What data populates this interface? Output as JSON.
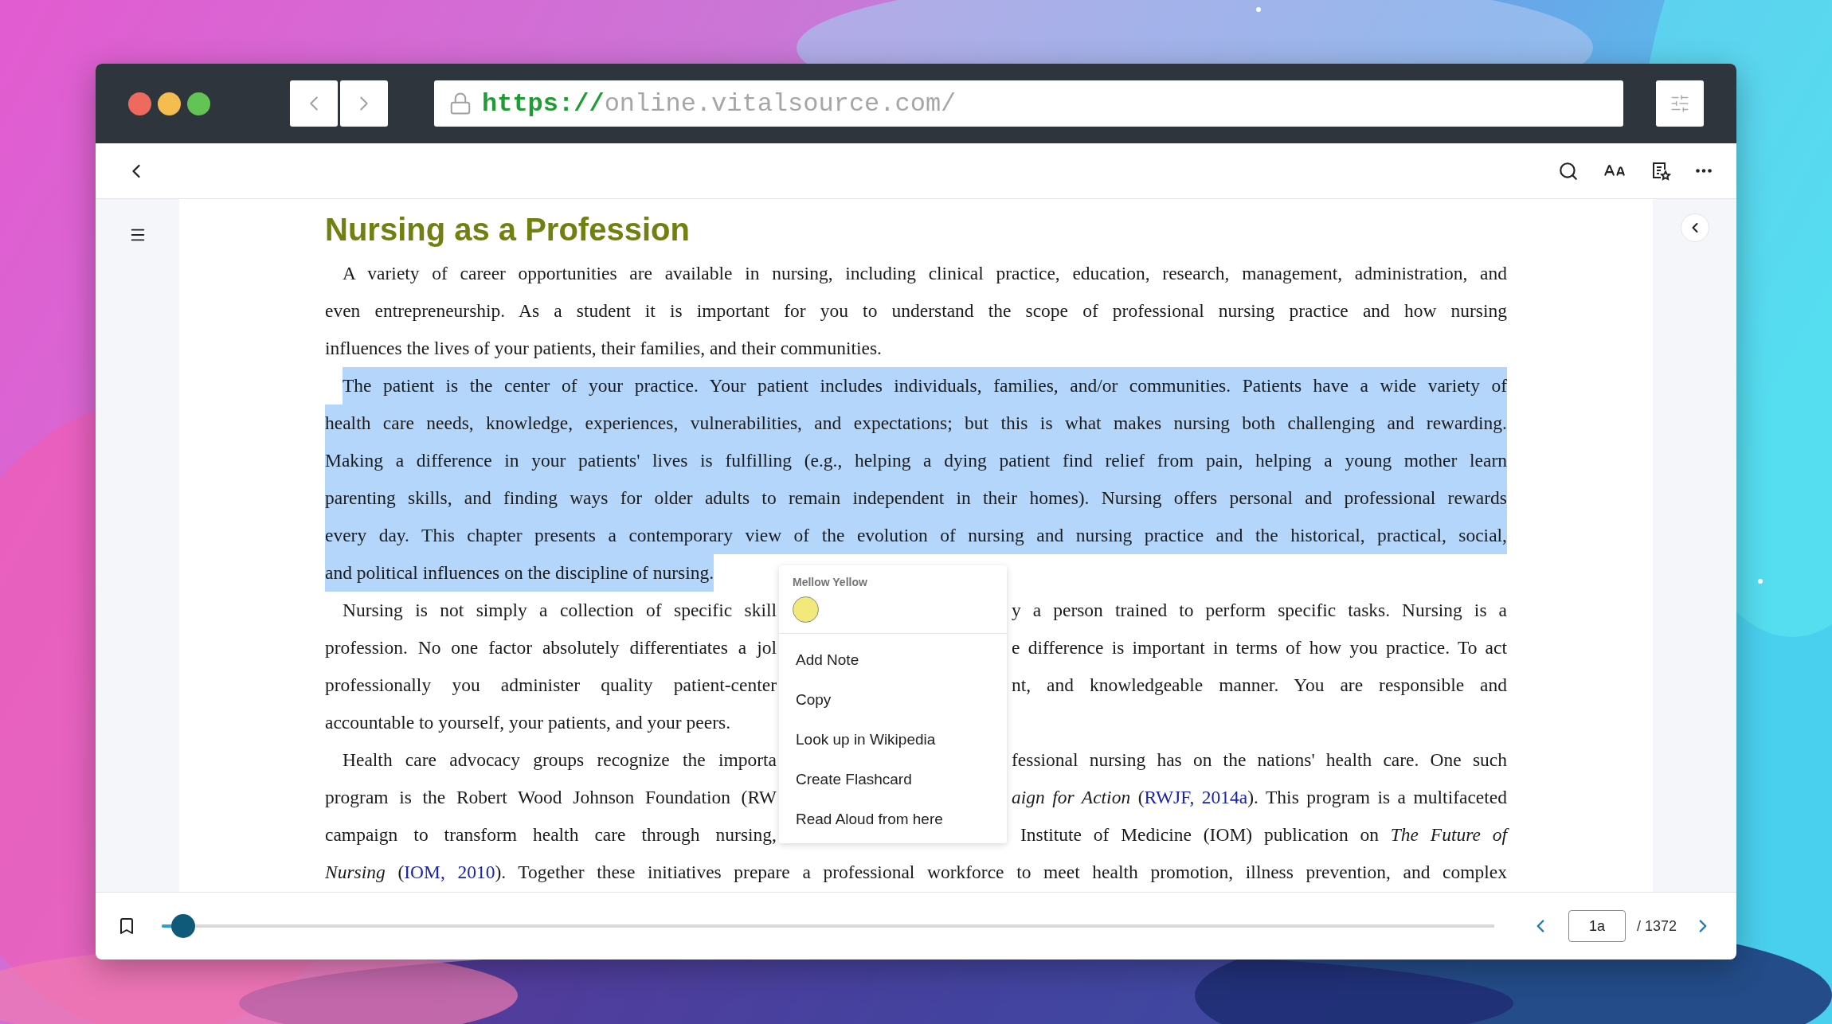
{
  "browser": {
    "url_scheme": "https://",
    "url_rest": "online.vitalsource.com/"
  },
  "book": {
    "heading": "Nursing as a Profession",
    "paragraphs": [
      {
        "highlighted": false,
        "lines": [
          {
            "kind": "full",
            "segments": [
              [
                {
                  "kind": "text",
                  "text": "A variety of career opportunities are available in nursing, including clinical practice, education, research, management, administration, and"
                }
              ]
            ]
          },
          {
            "kind": "full",
            "segments": [
              [
                {
                  "kind": "text",
                  "text": "even entrepreneurship. As a student it is important for you to understand the scope of professional nursing practice and how nursing"
                }
              ]
            ]
          },
          {
            "kind": "end",
            "segments": [
              [
                {
                  "kind": "text",
                  "text": "influences the lives of your patients, their families, and their communities."
                }
              ]
            ]
          }
        ]
      },
      {
        "highlighted": true,
        "lines": [
          {
            "kind": "full",
            "segments": [
              [
                {
                  "kind": "text",
                  "text": "The patient is the center of your practice. Your patient includes individuals, families, and/or communities. Patients have a wide variety of"
                }
              ]
            ]
          },
          {
            "kind": "full",
            "segments": [
              [
                {
                  "kind": "text",
                  "text": "health care needs, knowledge, experiences, vulnerabilities, and expectations; but this is what makes nursing both challenging and rewarding."
                }
              ]
            ]
          },
          {
            "kind": "full",
            "segments": [
              [
                {
                  "kind": "text",
                  "text": "Making a difference in your patients' lives is fulfilling (e.g., helping a dying patient find relief from pain, helping a young mother learn"
                }
              ]
            ]
          },
          {
            "kind": "full",
            "segments": [
              [
                {
                  "kind": "text",
                  "text": "parenting skills, and finding ways for older adults to remain independent in their homes). Nursing offers personal and professional rewards"
                }
              ]
            ]
          },
          {
            "kind": "full",
            "segments": [
              [
                {
                  "kind": "text",
                  "text": "every day. This chapter presents a contemporary view of the evolution of nursing and nursing practice and the historical, practical, social,"
                }
              ]
            ]
          },
          {
            "kind": "end",
            "segments": [
              [
                {
                  "kind": "text",
                  "text": "and political influences on the discipline of nursing."
                }
              ]
            ]
          }
        ]
      },
      {
        "highlighted": false,
        "lines": [
          {
            "kind": "split",
            "segments": [
              [
                {
                  "kind": "text",
                  "text": "Nursing is not simply a collection of specific skill"
                }
              ],
              [
                {
                  "kind": "text",
                  "text": "y a person trained to perform specific tasks. Nursing is a"
                }
              ]
            ]
          },
          {
            "kind": "split",
            "segments": [
              [
                {
                  "kind": "text",
                  "text": "profession. No one factor absolutely differentiates a jol"
                }
              ],
              [
                {
                  "kind": "text",
                  "text": "e difference is important in terms of how you practice. To act"
                }
              ]
            ]
          },
          {
            "kind": "split",
            "segments": [
              [
                {
                  "kind": "text",
                  "text": "professionally you administer quality patient-center"
                }
              ],
              [
                {
                  "kind": "text",
                  "text": "nt, and knowledgeable manner. You are responsible and"
                }
              ]
            ]
          },
          {
            "kind": "end",
            "segments": [
              [
                {
                  "kind": "text",
                  "text": "accountable to yourself, your patients, and your peers."
                }
              ]
            ]
          }
        ]
      },
      {
        "highlighted": false,
        "lines": [
          {
            "kind": "split",
            "segments": [
              [
                {
                  "kind": "text",
                  "text": "Health care advocacy groups recognize the importa"
                }
              ],
              [
                {
                  "kind": "text",
                  "text": "fessional nursing has on the nations' health care. One such"
                }
              ]
            ]
          },
          {
            "kind": "split",
            "segments": [
              [
                {
                  "kind": "text",
                  "text": "program is the Robert Wood Johnson Foundation (RW"
                }
              ],
              [
                {
                  "kind": "text",
                  "text": "*aign for Action* ("
                },
                {
                  "kind": "link",
                  "text": "RWJF, 2014a"
                },
                {
                  "kind": "text",
                  "text": "). This program is a multifaceted"
                }
              ]
            ]
          },
          {
            "kind": "gap",
            "segments": [
              [
                {
                  "kind": "text",
                  "text": "campaign to transform health care through nursing,"
                }
              ],
              [
                {
                  "kind": "text",
                  "text": "Institute of Medicine (IOM) publication on *The Future of*"
                }
              ]
            ]
          },
          {
            "kind": "full",
            "segments": [
              [
                {
                  "kind": "text",
                  "text": "*Nursing* ("
                },
                {
                  "kind": "link",
                  "text": "IOM, 2010"
                },
                {
                  "kind": "text",
                  "text": "). Together these initiatives prepare a professional workforce to meet health promotion, illness prevention, and complex"
                }
              ]
            ]
          }
        ]
      }
    ]
  },
  "context_menu": {
    "color_label": "Mellow Yellow",
    "swatches": [
      {
        "color": "#f3e97a"
      }
    ],
    "items": [
      "Add Note",
      "Copy",
      "Look up in Wikipedia",
      "Create Flashcard",
      "Read Aloud from here"
    ]
  },
  "footer": {
    "progress": {
      "level": 0.016
    },
    "page": "1a",
    "total": "/ 1372"
  }
}
